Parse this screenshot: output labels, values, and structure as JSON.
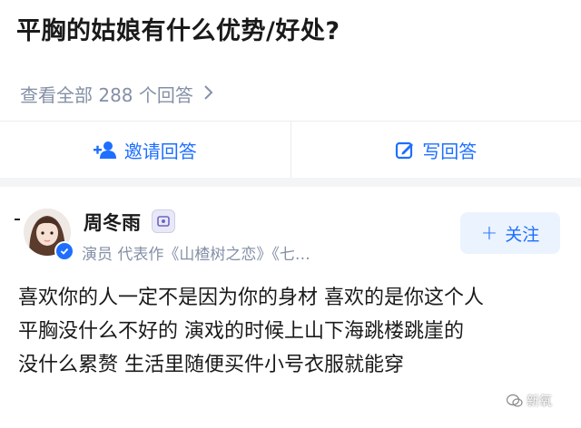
{
  "question": {
    "title": "平胸的姑娘有什么优势/好处?",
    "view_all": "查看全部 288 个回答"
  },
  "actions": {
    "invite": "邀请回答",
    "write": "写回答"
  },
  "author": {
    "name": "周冬雨",
    "description": "演员 代表作《山楂树之恋》《七…",
    "follow_label": "关注"
  },
  "answer": {
    "paragraphs": [
      "喜欢你的人一定不是因为你的身材 喜欢的是你这个人",
      "平胸没什么不好的 演戏的时候上山下海跳楼跳崖的",
      "没什么累赘 生活里随便买件小号衣服就能穿"
    ]
  },
  "watermark": {
    "text": "新氧"
  },
  "colors": {
    "accent": "#1e6fff",
    "muted": "#8590a6",
    "follow_bg": "#ebf3ff"
  }
}
